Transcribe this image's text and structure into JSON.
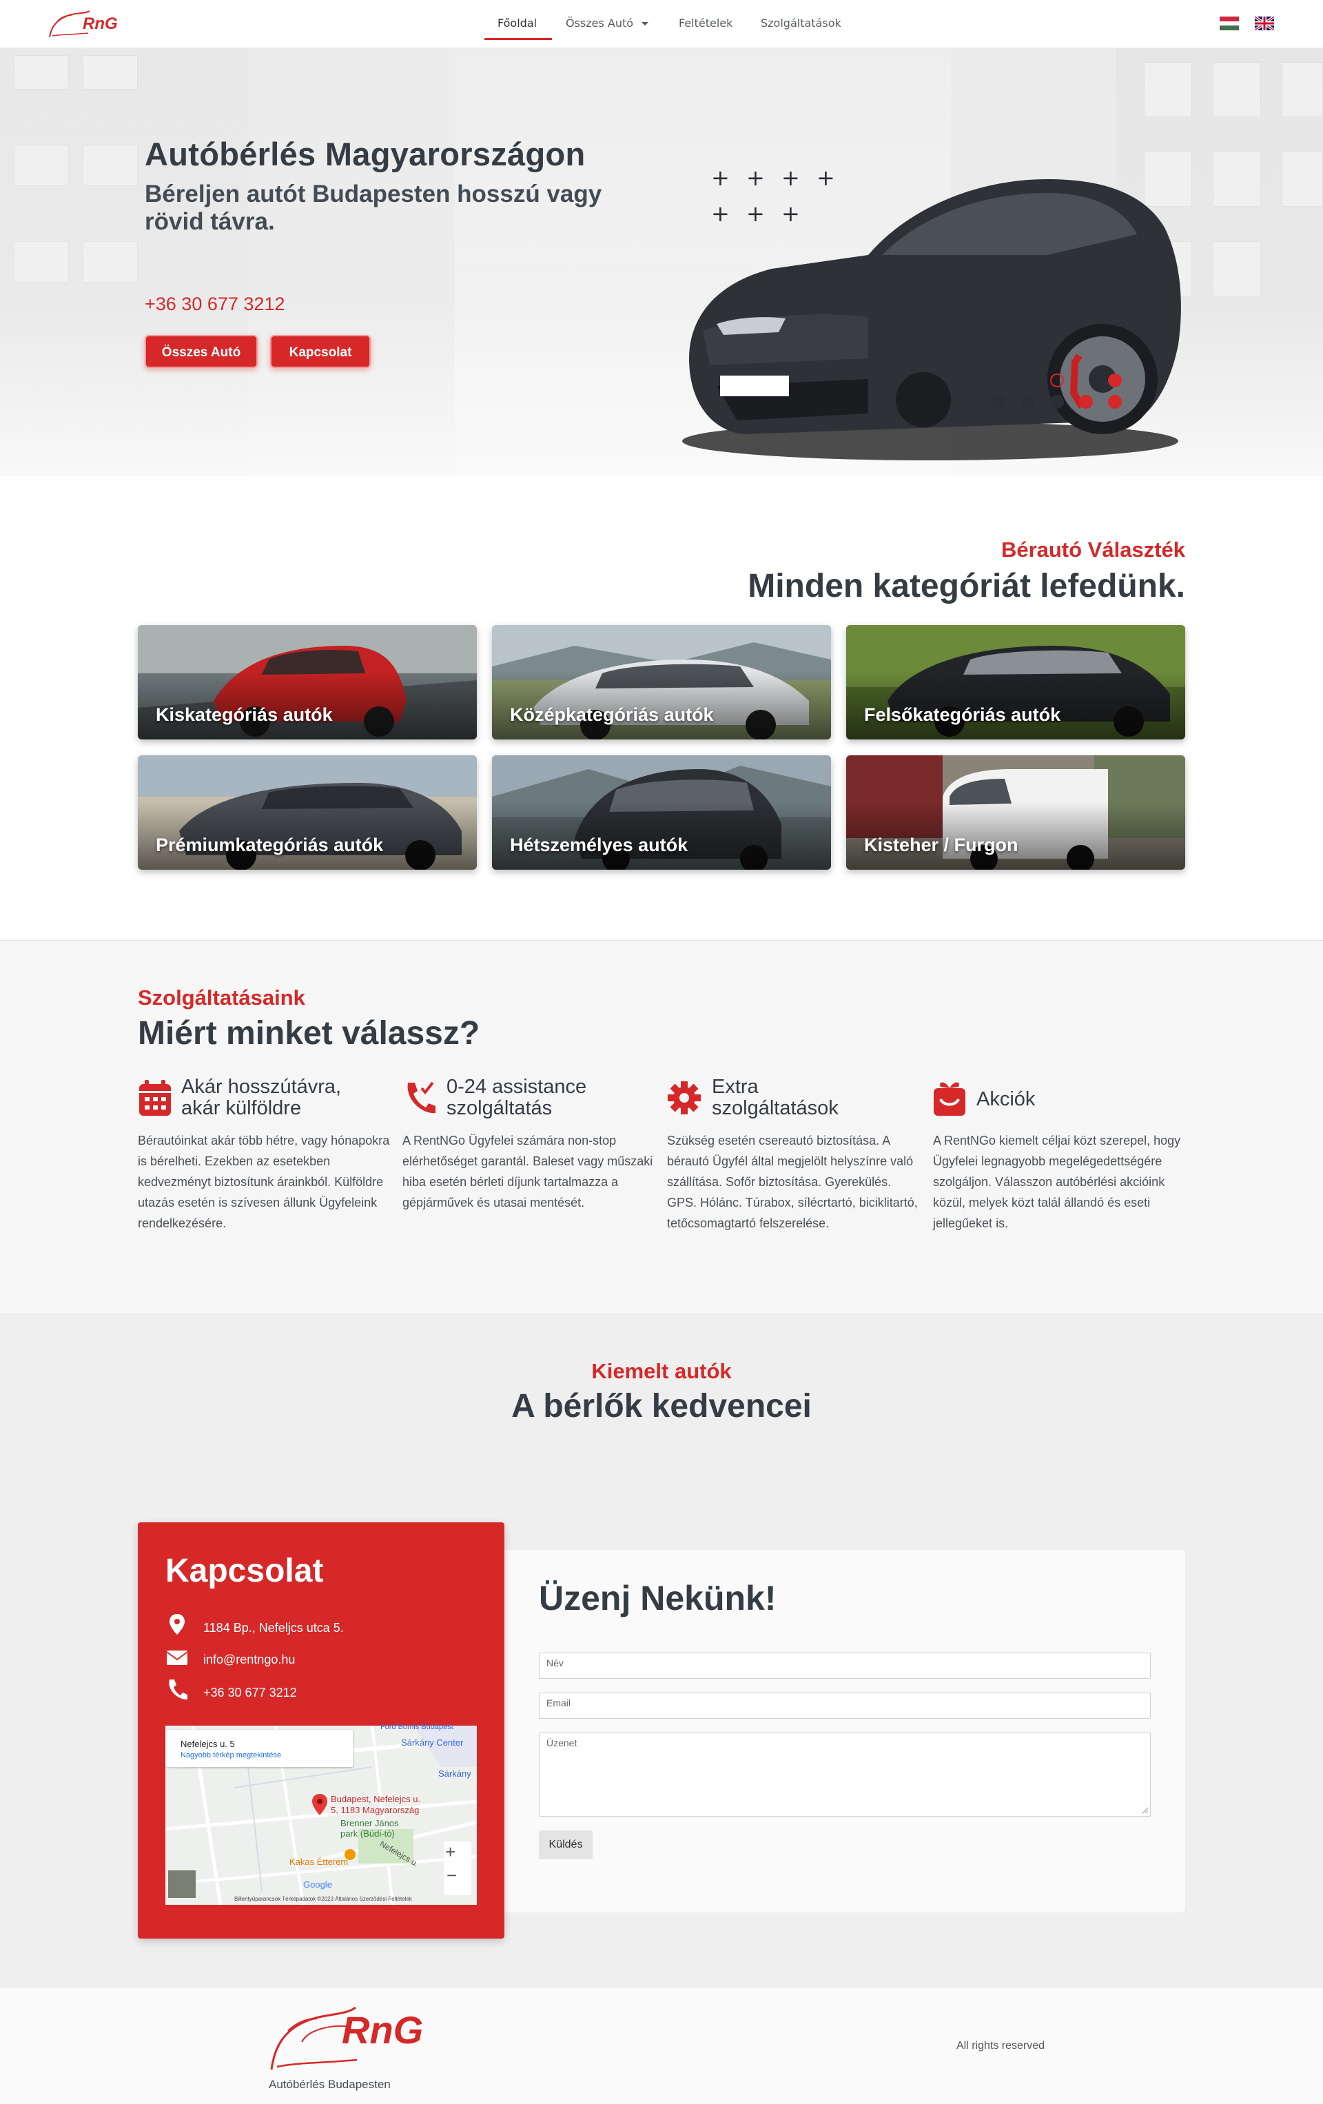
{
  "nav": {
    "logo_text": "RnG",
    "items": [
      {
        "label": "Főoldal",
        "active": true
      },
      {
        "label": "Összes Autó",
        "has_dropdown": true
      },
      {
        "label": "Feltételek"
      },
      {
        "label": "Szolgáltatások"
      }
    ],
    "languages": [
      "hu-flag-icon",
      "uk-flag-icon"
    ]
  },
  "hero": {
    "title": "Autóbérlés Magyarországon",
    "subtitle": "Béreljen autót Budapesten hosszú vagy rövid távra.",
    "phone": "+36 30 677 3212",
    "buttons": [
      {
        "label": "Összes Autó"
      },
      {
        "label": "Kapcsolat"
      }
    ]
  },
  "categories": {
    "eyebrow": "Bérautó Választék",
    "heading": "Minden kategóriát lefedünk.",
    "items": [
      {
        "label": "Kiskategóriás autók"
      },
      {
        "label": "Középkategóriás autók"
      },
      {
        "label": "Felsőkategóriás autók"
      },
      {
        "label": "Prémiumkategóriás autók"
      },
      {
        "label": "Hétszemélyes autók"
      },
      {
        "label": "Kisteher / Furgon"
      }
    ]
  },
  "services": {
    "eyebrow": "Szolgáltatásaink",
    "heading": "Miért minket válassz?",
    "items": [
      {
        "icon": "calendar-icon",
        "title_line1": "Akár hosszútávra,",
        "title_line2": "akár külföldre",
        "text": "Bérautóinkat akár több hétre, vagy hónapokra is bérelheti. Ezekben az esetekben kedvezményt biztosítunk árainkból. Külföldre utazás esetén is szívesen állunk Ügyfeleink rendelkezésére."
      },
      {
        "icon": "phone-check-icon",
        "title_line1": "0-24 assistance",
        "title_line2": "szolgáltatás",
        "text": "A RentNGo Ügyfelei számára non-stop elérhetőséget garantál. Baleset vagy műszaki hiba esetén bérleti díjunk tartalmazza a gépjárművek és utasai mentését."
      },
      {
        "icon": "gear-icon",
        "title_line1": "Extra",
        "title_line2": "szolgáltatások",
        "text": "Szükség esetén csereautó biztosítása. A bérautó Ügyfél által megjelölt helyszínre való szállítása. Sofőr biztosítása. Gyerekülés. GPS. Hólánc. Túrabox, sílécrtartó, biciklitartó, tetőcsomagtartó felszerelése."
      },
      {
        "icon": "gift-icon",
        "title_line1": "Akciók",
        "title_line2": "",
        "text": "A RentNGo kiemelt céljai közt szerepel, hogy Ügyfelei legnagyobb megelégedettségére szolgáljon. Válasszon autóbérlési akcióink közül, melyek közt talál állandó és eseti jellegűeket is."
      }
    ]
  },
  "featured": {
    "eyebrow": "Kiemelt autók",
    "heading": "A bérlők kedvencei"
  },
  "contact": {
    "title": "Kapcsolat",
    "address": "1184 Bp., Nefeljcs utca 5.",
    "email": "info@rentngo.hu",
    "phone": "+36 30 677 3212",
    "map": {
      "box_title": "Nefelejcs u. 5",
      "box_link": "Nagyobb térkép megtekintése",
      "pin_label_1": "Budapest, Nefelejcs u.",
      "pin_label_2": "5, 1183 Magyarország",
      "park_1": "Brenner János",
      "park_2": "park (Büdi-tó)",
      "restaurant": "Kakas Étterem",
      "place_1": "Sárkány Center",
      "place_2": "Sárkány",
      "place_3": "Ford Bomis Budapest",
      "street": "Nefelejcs u.",
      "zoom_in": "+",
      "zoom_out": "−",
      "footer": "Billentyűparancsok   Térképadatok ©2023   Általános Szerződési Feltételek",
      "google": "Google"
    },
    "form": {
      "title": "Üzenj Nekünk!",
      "name_placeholder": "Név",
      "email_placeholder": "Email",
      "message_placeholder": "Üzenet",
      "submit": "Küldés"
    }
  },
  "footer": {
    "logo_text": "RnG",
    "tagline": "Autóbérlés Budapesten",
    "rights": "All rights reserved"
  },
  "colors": {
    "brand_red": "#d62828",
    "dark_text": "#353c43"
  }
}
